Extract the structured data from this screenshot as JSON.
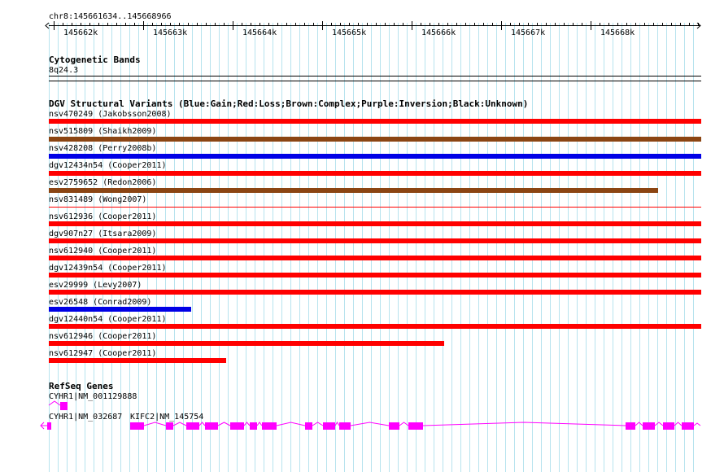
{
  "ruler": {
    "location": "chr8:145661634..145668966",
    "ticks": [
      "145662k",
      "145663k",
      "145664k",
      "145665k",
      "145666k",
      "145667k",
      "145668k"
    ]
  },
  "cytoband": {
    "title": "Cytogenetic Bands",
    "band": "8q24.3"
  },
  "dgv": {
    "title": "DGV Structural Variants (Blue:Gain;Red:Loss;Brown:Complex;Purple:Inversion;Black:Unknown)",
    "colors": {
      "loss": "#ff0000",
      "gain": "#0000e6",
      "complex": "#8b4513"
    },
    "variants": [
      {
        "label": "nsv470249 (Jakobsson2008)",
        "type": "loss"
      },
      {
        "label": "nsv515809 (Shaikh2009)",
        "type": "complex"
      },
      {
        "label": "nsv428208 (Perry2008b)",
        "type": "gain"
      },
      {
        "label": "dgv12434n54 (Cooper2011)",
        "type": "loss"
      },
      {
        "label": "esv2759652 (Redon2006)",
        "type": "complex"
      },
      {
        "label": "nsv831489 (Wong2007)",
        "type": "loss"
      },
      {
        "label": "nsv612936 (Cooper2011)",
        "type": "loss"
      },
      {
        "label": "dgv907n27 (Itsara2009)",
        "type": "loss"
      },
      {
        "label": "nsv612940 (Cooper2011)",
        "type": "loss"
      },
      {
        "label": "dgv12439n54 (Cooper2011)",
        "type": "loss"
      },
      {
        "label": "esv29999 (Levy2007)",
        "type": "loss"
      },
      {
        "label": "esv26548 (Conrad2009)",
        "type": "gain"
      },
      {
        "label": "dgv12440n54 (Cooper2011)",
        "type": "loss"
      },
      {
        "label": "nsv612946 (Cooper2011)",
        "type": "loss"
      },
      {
        "label": "nsv612947 (Cooper2011)",
        "type": "loss"
      }
    ]
  },
  "refseq": {
    "title": "RefSeq Genes",
    "gene_color": "#ff00ff",
    "genes": [
      {
        "label": "CYHR1|NM_001129888"
      },
      {
        "label": "CYHR1|NM_032687"
      },
      {
        "label": "KIFC2|NM_145754"
      }
    ]
  }
}
